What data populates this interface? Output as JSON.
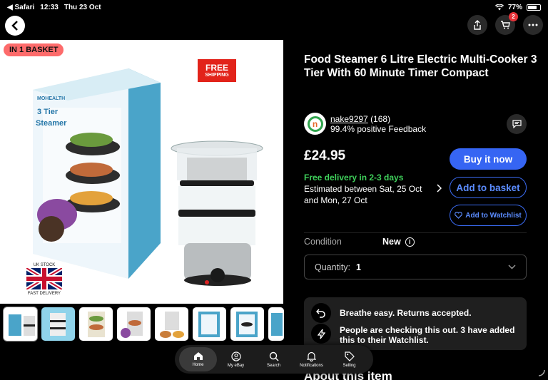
{
  "status": {
    "app": "◀ Safari",
    "time": "12:33",
    "date": "Thu 23 Oct",
    "battery": "77%"
  },
  "nav": {
    "cart_count": "2"
  },
  "gallery": {
    "badge": "IN 1 BASKET",
    "free_shipping_line1": "FREE",
    "free_shipping_line2": "SHIPPING",
    "uk_stock": "UK STOCK",
    "fast_delivery": "FAST DELIVERY",
    "thumb_count": 8
  },
  "product": {
    "title": "Food Steamer 6 Litre  Electric Multi-Cooker 3 Tier With 60 Minute Timer Compact",
    "price": "£24.95",
    "free_delivery": "Free delivery in 2-3 days",
    "estimated": "Estimated between Sat, 25 Oct",
    "estimated2": "and Mon, 27 Oct"
  },
  "seller": {
    "logo_letter": "n",
    "name": "nake9297",
    "count": "(168)",
    "feedback": "99.4% positive Feedback"
  },
  "actions": {
    "buy": "Buy it now",
    "add": "Add to basket",
    "watch": "Add to Watchlist"
  },
  "condition": {
    "label": "Condition",
    "value": "New"
  },
  "quantity": {
    "label": "Quantity:",
    "value": "1"
  },
  "promo": {
    "returns": "Breathe easy. Returns accepted.",
    "watching": "People are checking this out. 3 have added this to their Watchlist."
  },
  "about": "About this item",
  "tabs": [
    {
      "label": "Home",
      "icon": "home-icon"
    },
    {
      "label": "My eBay",
      "icon": "person-icon"
    },
    {
      "label": "Search",
      "icon": "search-icon"
    },
    {
      "label": "Notifications",
      "icon": "bell-icon"
    },
    {
      "label": "Selling",
      "icon": "tag-icon"
    }
  ]
}
